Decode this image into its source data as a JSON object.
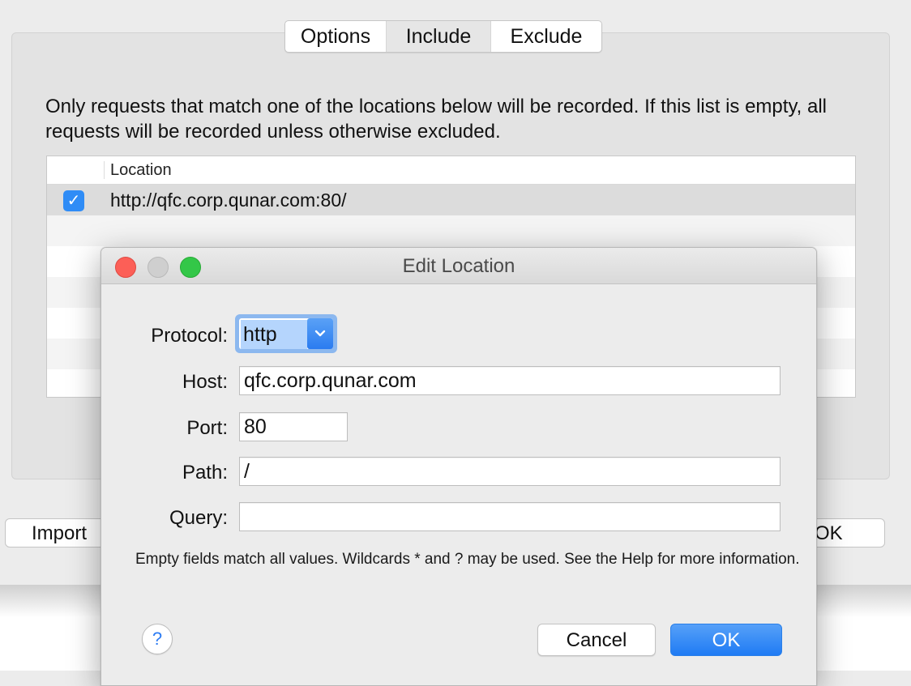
{
  "tabs": [
    {
      "label": "Options"
    },
    {
      "label": "Include"
    },
    {
      "label": "Exclude"
    }
  ],
  "selected_tab": "Include",
  "description": "Only requests that match one of the locations below will be recorded. If this list is empty, all requests will be recorded unless otherwise excluded.",
  "table": {
    "column_header": "Location",
    "rows": [
      {
        "enabled": true,
        "location": "http://qfc.corp.qunar.com:80/"
      }
    ]
  },
  "background_buttons": {
    "import_label": "Import",
    "ok_label": "OK"
  },
  "dialog": {
    "title": "Edit Location",
    "protocol": {
      "label": "Protocol:",
      "value": "http"
    },
    "host": {
      "label": "Host:",
      "value": "qfc.corp.qunar.com"
    },
    "port": {
      "label": "Port:",
      "value": "80"
    },
    "path": {
      "label": "Path:",
      "value": "/"
    },
    "query": {
      "label": "Query:",
      "value": ""
    },
    "help_text": "Empty fields match all values. Wildcards * and ? may be used. See the Help for more information.",
    "help_button": "?",
    "cancel_label": "Cancel",
    "ok_label": "OK"
  },
  "colors": {
    "accent": "#2f8cf6",
    "close": "#fc5f57",
    "zoom": "#33c748"
  }
}
